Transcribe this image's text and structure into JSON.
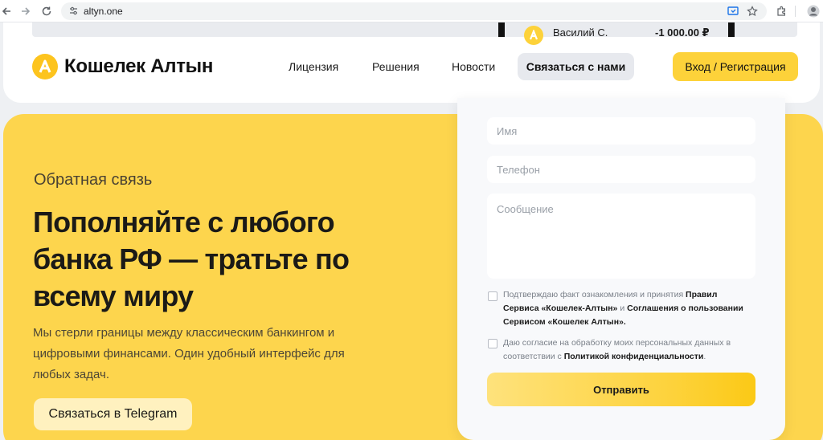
{
  "browser": {
    "url": "altyn.one"
  },
  "promo": {
    "name": "Василий С.",
    "amount": "-1 000.00 ₽"
  },
  "header": {
    "logo_text": "Кошелек Алтын",
    "nav": [
      "Лицензия",
      "Решения",
      "Новости"
    ],
    "contact_label": "Связаться с нами",
    "login_label": "Вход / Регистрация"
  },
  "hero": {
    "subtitle": "Обратная связь",
    "title": "Пополняйте с любого банка РФ — тратьте по всему миру",
    "description": "Мы стерли границы между классическим банкингом и цифровыми финансами. Один удобный интерфейс для любых задач.",
    "telegram_label": "Связаться в Telegram"
  },
  "form": {
    "name_placeholder": "Имя",
    "phone_placeholder": "Телефон",
    "message_placeholder": "Сообщение",
    "consent1": {
      "t1": "Подтверждаю факт ознакомления и принятия ",
      "b1": "Правил Сервиса «Кошелек-Алтын»",
      "t2": " и ",
      "b2": "Соглашения о пользовании Сервисом «Кошелек Алтын».",
      "t3": ""
    },
    "consent2": {
      "t1": "Даю согласие на обработку моих персональных данных в соответствии с ",
      "b1": "Политикой конфиденциальности",
      "t2": "."
    },
    "submit_label": "Отправить"
  },
  "colors": {
    "accent": "#fdd23a",
    "hero_bg": "#fdd54d"
  }
}
